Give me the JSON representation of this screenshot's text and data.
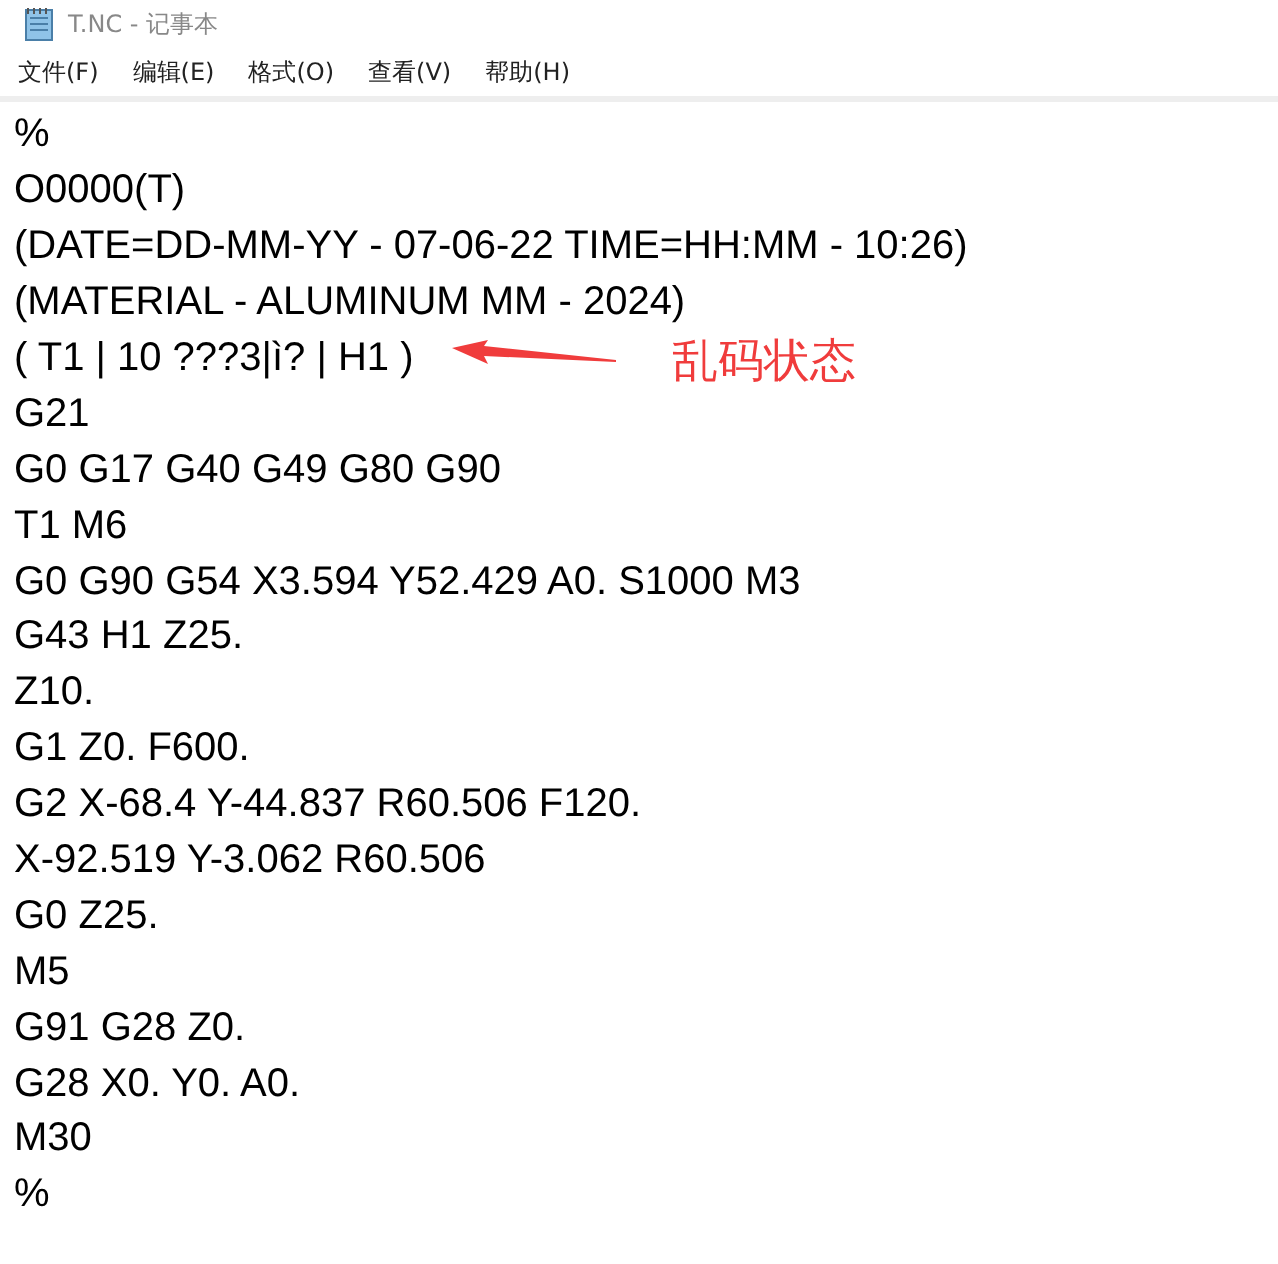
{
  "window": {
    "title": "T.NC - 记事本"
  },
  "menu": [
    "文件(F)",
    "编辑(E)",
    "格式(O)",
    "查看(V)",
    "帮助(H)"
  ],
  "lines": [
    "%",
    "O0000(T)",
    "(DATE=DD-MM-YY - 07-06-22 TIME=HH:MM - 10:26)",
    "(MATERIAL - ALUMINUM MM - 2024)",
    {
      "text": "( T1 | 10 ???3|ì? | H1 )",
      "annotation": "乱码状态"
    },
    "G21",
    "G0 G17 G40 G49 G80 G90",
    "T1 M6",
    "G0 G90 G54 X3.594 Y52.429 A0. S1000 M3",
    "G43 H1 Z25.",
    "Z10.",
    "G1 Z0. F600.",
    "G2 X-68.4 Y-44.837 R60.506 F120.",
    "X-92.519 Y-3.062 R60.506",
    "G0 Z25.",
    "M5",
    "G91 G28 Z0.",
    "G28 X0. Y0. A0.",
    "M30",
    "%"
  ]
}
